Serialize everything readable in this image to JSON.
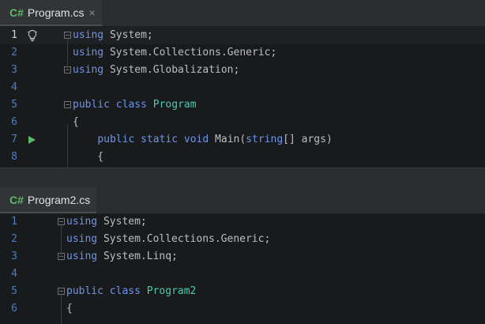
{
  "top_editor": {
    "tab": {
      "lang": "C#",
      "filename": "Program.cs",
      "close": "×"
    },
    "lines": [
      {
        "n": "1",
        "tokens": [
          {
            "t": "using",
            "c": "kw"
          },
          {
            "t": " System;",
            "c": "id"
          }
        ]
      },
      {
        "n": "2",
        "tokens": [
          {
            "t": "using",
            "c": "kw"
          },
          {
            "t": " System.Collections.Generic;",
            "c": "id"
          }
        ]
      },
      {
        "n": "3",
        "tokens": [
          {
            "t": "using",
            "c": "kw"
          },
          {
            "t": " System.Globalization;",
            "c": "id"
          }
        ]
      },
      {
        "n": "4",
        "tokens": []
      },
      {
        "n": "5",
        "tokens": [
          {
            "t": "public",
            "c": "kw"
          },
          {
            "t": " ",
            "c": "id"
          },
          {
            "t": "class",
            "c": "kw"
          },
          {
            "t": " ",
            "c": "id"
          },
          {
            "t": "Program",
            "c": "ty"
          }
        ]
      },
      {
        "n": "6",
        "tokens": [
          {
            "t": "{",
            "c": "id"
          }
        ]
      },
      {
        "n": "7",
        "tokens": [
          {
            "t": "    ",
            "c": "id"
          },
          {
            "t": "public",
            "c": "kw"
          },
          {
            "t": " ",
            "c": "id"
          },
          {
            "t": "static",
            "c": "kw"
          },
          {
            "t": " ",
            "c": "id"
          },
          {
            "t": "void",
            "c": "kw"
          },
          {
            "t": " Main(",
            "c": "id"
          },
          {
            "t": "string",
            "c": "kw"
          },
          {
            "t": "[] args)",
            "c": "id"
          }
        ]
      },
      {
        "n": "8",
        "tokens": [
          {
            "t": "    {",
            "c": "id"
          }
        ]
      }
    ]
  },
  "bottom_editor": {
    "tab": {
      "lang": "C#",
      "filename": "Program2.cs"
    },
    "lines": [
      {
        "n": "1",
        "tokens": [
          {
            "t": "using",
            "c": "kw"
          },
          {
            "t": " System;",
            "c": "id"
          }
        ]
      },
      {
        "n": "2",
        "tokens": [
          {
            "t": "using",
            "c": "kw"
          },
          {
            "t": " System.Collections.Generic;",
            "c": "id"
          }
        ]
      },
      {
        "n": "3",
        "tokens": [
          {
            "t": "using",
            "c": "kw"
          },
          {
            "t": " System.Linq;",
            "c": "id"
          }
        ]
      },
      {
        "n": "4",
        "tokens": []
      },
      {
        "n": "5",
        "tokens": [
          {
            "t": "public",
            "c": "kw"
          },
          {
            "t": " ",
            "c": "id"
          },
          {
            "t": "class",
            "c": "kw"
          },
          {
            "t": " ",
            "c": "id"
          },
          {
            "t": "Program2",
            "c": "ty"
          }
        ]
      },
      {
        "n": "6",
        "tokens": [
          {
            "t": "{",
            "c": "id"
          }
        ]
      }
    ]
  },
  "colors": {
    "keyword": "#6c95eb",
    "type": "#4ec9b0",
    "identifier": "#bcbec4",
    "line_number": "#4b7ec4",
    "lang_badge": "#5fb865"
  },
  "icons": {
    "top_line1": "lightbulb-icon",
    "top_line7": "run-icon",
    "fold": "fold-icon"
  }
}
